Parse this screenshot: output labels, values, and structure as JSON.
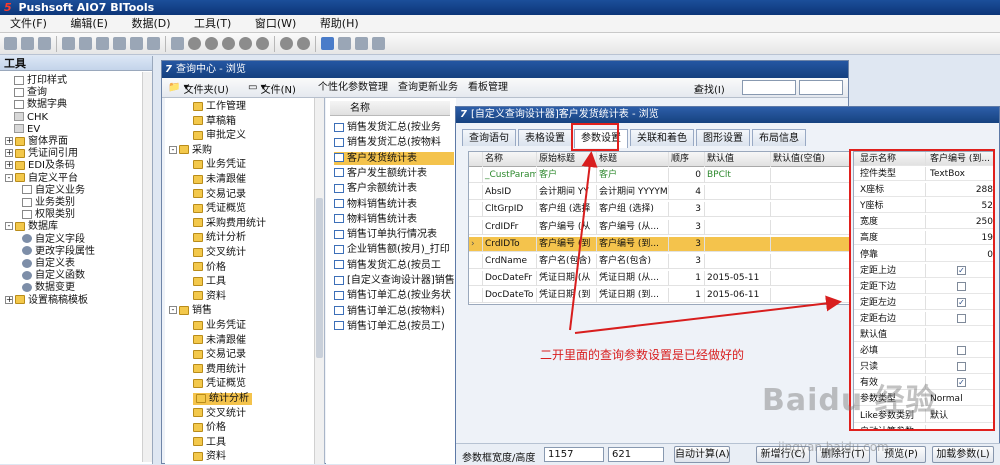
{
  "app": {
    "title": "Pushsoft AIO7 BITools",
    "logo": "5"
  },
  "menu": [
    "文件(F)",
    "编辑(E)",
    "数据(D)",
    "工具(T)",
    "窗口(W)",
    "帮助(H)"
  ],
  "left_panel": {
    "title": "工具",
    "items": [
      {
        "label": "打印样式",
        "icon": "doc"
      },
      {
        "label": "查询",
        "icon": "doc"
      },
      {
        "label": "数据字典",
        "icon": "doc"
      },
      {
        "label": "CHK",
        "icon": "small"
      },
      {
        "label": "EV",
        "icon": "small"
      },
      {
        "label": "窗体界面",
        "icon": "fold",
        "pm": "+"
      },
      {
        "label": "凭证间引用",
        "icon": "fold",
        "pm": "+"
      },
      {
        "label": "EDI及条码",
        "icon": "fold",
        "pm": "+"
      },
      {
        "label": "自定义平台",
        "icon": "fold",
        "pm": "-"
      },
      {
        "label": "自定义业务",
        "icon": "doc",
        "indent": true
      },
      {
        "label": "业务类别",
        "icon": "doc",
        "indent": true
      },
      {
        "label": "权限类别",
        "icon": "doc",
        "indent": true
      },
      {
        "label": "数据库",
        "icon": "fold",
        "pm": "-"
      },
      {
        "label": "自定义字段",
        "icon": "tool",
        "indent": true
      },
      {
        "label": "更改字段属性",
        "icon": "tool",
        "indent": true
      },
      {
        "label": "自定义表",
        "icon": "tool",
        "indent": true
      },
      {
        "label": "自定义函数",
        "icon": "tool",
        "indent": true
      },
      {
        "label": "数据变更",
        "icon": "tool",
        "indent": true
      },
      {
        "label": "设置稿稿模板",
        "icon": "fold",
        "pm": "+"
      }
    ]
  },
  "query_center": {
    "title": "查询中心 - 浏览",
    "toolbar": {
      "folder_menu": "文件夹(U)",
      "file_menu": "文件(N)",
      "personalize": "个性化参数管理",
      "update_business": "查询更新业务",
      "board_manage": "看板管理",
      "find": "查找(I)"
    },
    "tree": [
      {
        "label": "工作管理",
        "level": 2
      },
      {
        "label": "草稿箱",
        "level": 2
      },
      {
        "label": "审批定义",
        "level": 2
      },
      {
        "label": "采购",
        "level": 1
      },
      {
        "label": "业务凭证",
        "level": 2
      },
      {
        "label": "未清跟催",
        "level": 2
      },
      {
        "label": "交易记录",
        "level": 2
      },
      {
        "label": "凭证概览",
        "level": 2
      },
      {
        "label": "采购费用统计",
        "level": 2
      },
      {
        "label": "统计分析",
        "level": 2
      },
      {
        "label": "交叉统计",
        "level": 2
      },
      {
        "label": "价格",
        "level": 2
      },
      {
        "label": "工具",
        "level": 2
      },
      {
        "label": "资料",
        "level": 2
      },
      {
        "label": "销售",
        "level": 1
      },
      {
        "label": "业务凭证",
        "level": 2
      },
      {
        "label": "未清跟催",
        "level": 2
      },
      {
        "label": "交易记录",
        "level": 2
      },
      {
        "label": "费用统计",
        "level": 2
      },
      {
        "label": "凭证概览",
        "level": 2
      },
      {
        "label": "统计分析",
        "level": 2,
        "selected": true
      },
      {
        "label": "交叉统计",
        "level": 2
      },
      {
        "label": "价格",
        "level": 2
      },
      {
        "label": "工具",
        "level": 2
      },
      {
        "label": "资料",
        "level": 2
      }
    ],
    "list_header": "名称",
    "list": [
      {
        "label": "销售发货汇总(按业务"
      },
      {
        "label": "销售发货汇总(按物料"
      },
      {
        "label": "客户发货统计表",
        "selected": true
      },
      {
        "label": "客户发生额统计表"
      },
      {
        "label": "客户余额统计表"
      },
      {
        "label": "物料销售统计表"
      },
      {
        "label": "物料销售统计表"
      },
      {
        "label": "销售订单执行情况表"
      },
      {
        "label": "企业销售额(按月)_打印"
      },
      {
        "label": "销售发货汇总(按员工"
      },
      {
        "label": "[自定义查询设计器]销售"
      },
      {
        "label": "销售订单汇总(按业务状"
      },
      {
        "label": "销售订单汇总(按物料)"
      },
      {
        "label": "销售订单汇总(按员工)"
      }
    ]
  },
  "designer": {
    "title": "[自定义查询设计器]客户发货统计表 - 浏览",
    "tabs": [
      "查询语句",
      "表格设置",
      "参数设置",
      "关联和着色",
      "图形设置",
      "布局信息"
    ],
    "active_tab": 2,
    "grid_columns": [
      "名称",
      "原始标题",
      "标题",
      "顺序",
      "默认值",
      "默认值(空值)"
    ],
    "grid_rows": [
      {
        "name": "_CustParam",
        "orig": "客户",
        "title": "客户",
        "order": "0",
        "default": "BPClt",
        "default_null": "",
        "green": true
      },
      {
        "name": "AbsID",
        "orig": "会计期间 YY",
        "title": "会计期间 YYYYM",
        "order": "4",
        "default": "",
        "default_null": ""
      },
      {
        "name": "CltGrpID",
        "orig": "客户组 (选择",
        "title": "客户组 (选择)",
        "order": "3",
        "default": "",
        "default_null": ""
      },
      {
        "name": "CrdIDFr",
        "orig": "客户编号 (从",
        "title": "客户编号 (从...",
        "order": "3",
        "default": "",
        "default_null": ""
      },
      {
        "name": "CrdIDTo",
        "orig": "客户编号 (到",
        "title": "客户编号 (到...",
        "order": "3",
        "default": "",
        "default_null": "",
        "selected": true
      },
      {
        "name": "CrdName",
        "orig": "客户名(包含)",
        "title": "客户名(包含)",
        "order": "3",
        "default": "",
        "default_null": ""
      },
      {
        "name": "DocDateFr",
        "orig": "凭证日期 (从",
        "title": "凭证日期 (从...",
        "order": "1",
        "default": "2015-05-11",
        "default_null": ""
      },
      {
        "name": "DocDateTo",
        "orig": "凭证日期 (到",
        "title": "凭证日期 (到...",
        "order": "1",
        "default": "2015-06-11",
        "default_null": ""
      }
    ],
    "props": {
      "header": {
        "name": "显示名称",
        "value": "客户编号 (到..."
      },
      "rows": [
        {
          "name": "控件类型",
          "value": "TextBox"
        },
        {
          "name": "X座标",
          "value": "288",
          "num": true
        },
        {
          "name": "Y座标",
          "value": "52",
          "num": true
        },
        {
          "name": "宽度",
          "value": "250",
          "num": true
        },
        {
          "name": "高度",
          "value": "19",
          "num": true
        },
        {
          "name": "停靠",
          "value": "0",
          "num": true
        },
        {
          "name": "定距上边",
          "check": true
        },
        {
          "name": "定距下边",
          "check": false
        },
        {
          "name": "定距左边",
          "check": true
        },
        {
          "name": "定距右边",
          "check": false
        },
        {
          "name": "默认值",
          "value": ""
        },
        {
          "name": "必填",
          "check": false
        },
        {
          "name": "只读",
          "check": false
        },
        {
          "name": "有效",
          "check": true
        },
        {
          "name": "参数类型",
          "value": "Normal"
        },
        {
          "name": "Like参数类别",
          "value": "默认"
        },
        {
          "name": "自动计算参数",
          "value": ""
        }
      ]
    },
    "bottom": {
      "size_label": "参数框宽度/高度",
      "width_value": "1157",
      "height_value": "621",
      "auto_calc": "自动计算(A)",
      "new_row": "新增行(C)",
      "delete_row": "删除行(T)",
      "preview": "预览(P)",
      "add_param": "加载参数(L)"
    }
  },
  "annotation": "二开里面的查询参数设置是已经做好的",
  "watermark": {
    "main": "Baidu 经验",
    "sub": "jingyan.baidu.com"
  },
  "colors": {
    "title_bar": "#0c3578",
    "selection": "#f4c34c",
    "highlight": "#e0201d"
  }
}
